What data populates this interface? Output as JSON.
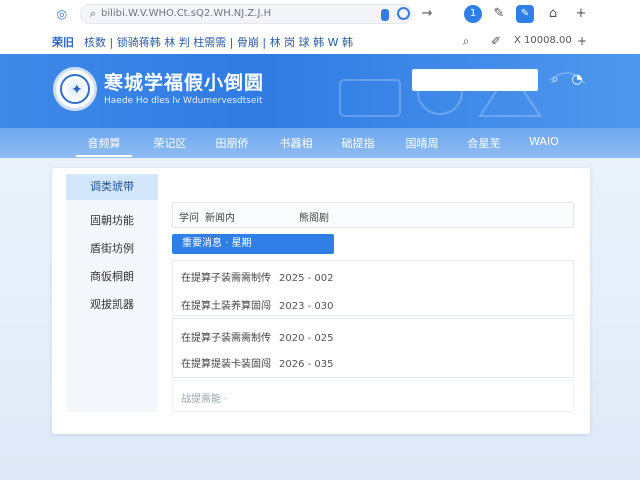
{
  "browser": {
    "site_icon": "compass-icon",
    "url": "bilibi.W.V.WHO.Ct.sQ2.WH.NJ.Z.J.H",
    "buttons": {
      "forward": "→",
      "profile": "1",
      "extension": "✎",
      "home": "⌂",
      "new_tab": "+"
    }
  },
  "toolbar": {
    "left_label": "荣旧",
    "links": "核数 | 锁骑蒋韩 林 判 柱需需 | 骨崩 | 林 岗 球 韩 W 韩",
    "status": "X 10008.00",
    "add": "+"
  },
  "hero": {
    "title": "寒城学福假小倒圆",
    "subtitle": "Haede Ho dles lv Wdumervesdtseit",
    "search_placeholder": "",
    "logo_icon": "school-emblem-icon"
  },
  "nav": {
    "items": [
      {
        "label": "音频算",
        "active": true
      },
      {
        "label": "荣记区",
        "active": false
      },
      {
        "label": "田朋侨",
        "active": false
      },
      {
        "label": "书器相",
        "active": false
      },
      {
        "label": "础提指",
        "active": false
      },
      {
        "label": "国晴周",
        "active": false
      },
      {
        "label": "合星芜",
        "active": false
      },
      {
        "label": "WAIO",
        "active": false
      }
    ]
  },
  "sidebar": {
    "items": [
      {
        "label": "调类琥带",
        "active": true
      },
      {
        "label": "固朝坊能",
        "active": false
      },
      {
        "label": "盾街坊例",
        "active": false
      },
      {
        "label": "商仮桐朗",
        "active": false
      },
      {
        "label": "观拔凯器",
        "active": false
      }
    ]
  },
  "content": {
    "header": {
      "col1": "学问",
      "col2": "新闻内",
      "col3": "熊阁剧"
    },
    "selected": "重要消息 · 星期",
    "group1": [
      {
        "title": "在提算子装需需制传",
        "date": "2025 - 002"
      },
      {
        "title": "在提算土装养算固闯",
        "date": "2023 - 030"
      }
    ],
    "group2": [
      {
        "title": "在提算子装需需制传",
        "date": "2020 - 025"
      },
      {
        "title": "在提算提装卡装固闯",
        "date": "2026 - 035"
      }
    ],
    "more": "战提需能 ·"
  },
  "colors": {
    "accent": "#2f7fe6",
    "hero_bg": "#3a85e6",
    "nav_bg": "#7eb1ef"
  }
}
